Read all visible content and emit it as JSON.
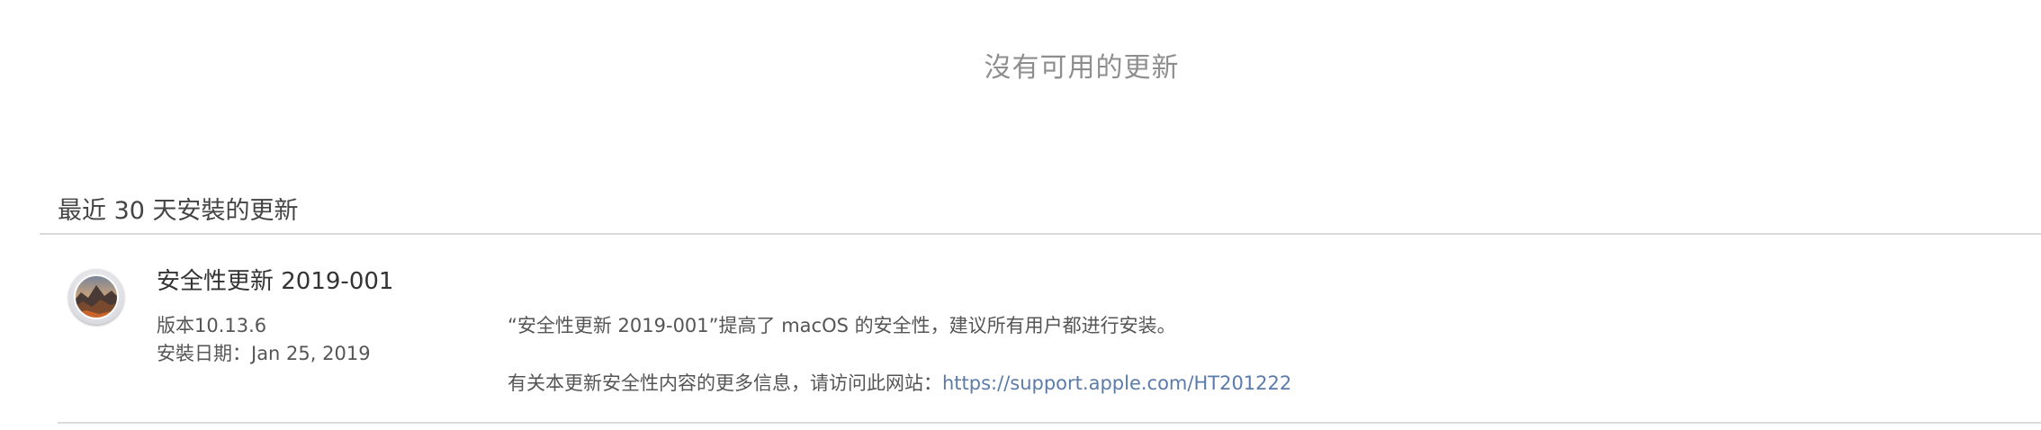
{
  "status": {
    "no_updates": "沒有可用的更新"
  },
  "recent": {
    "title": "最近 30 天安裝的更新"
  },
  "update": {
    "name": "安全性更新 2019-001",
    "version": "版本10.13.6",
    "install_date": "安裝日期：Jan 25, 2019",
    "description": "“安全性更新 2019-001”提高了 macOS 的安全性，建议所有用户都进行安装。",
    "info_prefix": "有关本更新安全性内容的更多信息，请访问此网站：",
    "info_link": "https://support.apple.com/HT201222",
    "icon": "macos-high-sierra-icon"
  },
  "colors": {
    "link": "#5b7bab",
    "muted_text": "#8e8e8e",
    "divider": "#d9d9d9"
  }
}
